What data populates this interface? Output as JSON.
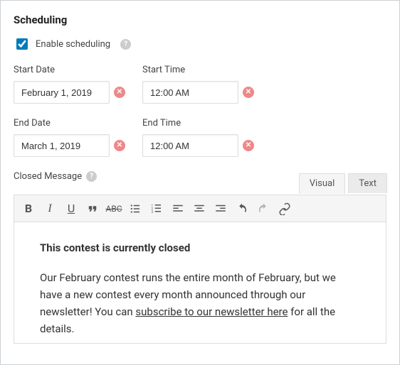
{
  "title": "Scheduling",
  "enable": {
    "label": "Enable scheduling",
    "checked": true
  },
  "fields": {
    "start_date": {
      "label": "Start Date",
      "value": "February 1, 2019"
    },
    "start_time": {
      "label": "Start Time",
      "value": "12:00 AM"
    },
    "end_date": {
      "label": "End Date",
      "value": "March 1, 2019"
    },
    "end_time": {
      "label": "End Time",
      "value": "12:00 AM"
    }
  },
  "closed_message_label": "Closed Message",
  "editor": {
    "tabs": {
      "visual": "Visual",
      "text": "Text"
    },
    "content": {
      "heading": "This contest is currently closed",
      "body_before": "Our February contest runs the entire month of February, but we have a new contest every month announced through our newsletter! You can ",
      "link": "subscribe to our newsletter here",
      "body_after": " for all the details."
    }
  }
}
